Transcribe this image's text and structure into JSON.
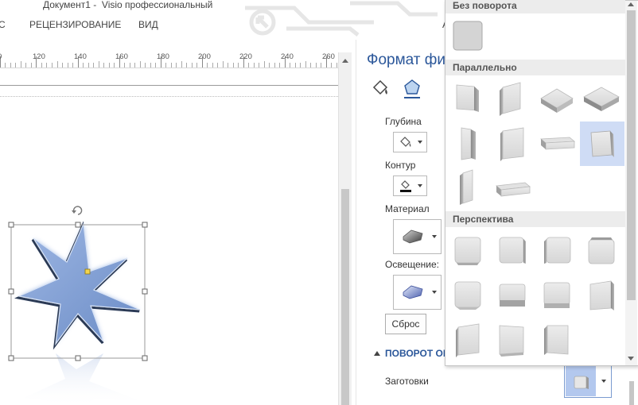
{
  "window": {
    "title": "Документ1 -  Visio профессиональный"
  },
  "ribbon": {
    "tabs": [
      {
        "label": "С"
      },
      {
        "label": "РЕЦЕНЗИРОВАНИЕ"
      },
      {
        "label": "ВИД"
      },
      {
        "label": "А"
      }
    ]
  },
  "ruler": {
    "ticks": [
      "0",
      "120",
      "140",
      "160",
      "180",
      "200",
      "220",
      "240",
      "260"
    ]
  },
  "pane": {
    "title": "Формат фи",
    "depth_label": "Глубина",
    "contour_label": "Контур",
    "material_label": "Материал",
    "lighting_label": "Освещение:",
    "reset_label": "Сброс",
    "rotation_header": "ПОВОРОТ ОБ",
    "presets_label": "Заготовки"
  },
  "gallery": {
    "sections": [
      {
        "label": "Без поворота"
      },
      {
        "label": "Параллельно"
      },
      {
        "label": "Перспектива"
      }
    ]
  },
  "colors": {
    "accent": "#2b579a",
    "star_fill": "#7d9cd1",
    "selection": "#cfdcf5"
  },
  "icons": [
    "fill-line-icon",
    "effects-pentagon-icon",
    "paint-bucket-icon",
    "pen-outline-icon",
    "material-icon",
    "lighting-icon",
    "rotate-handle-icon"
  ]
}
